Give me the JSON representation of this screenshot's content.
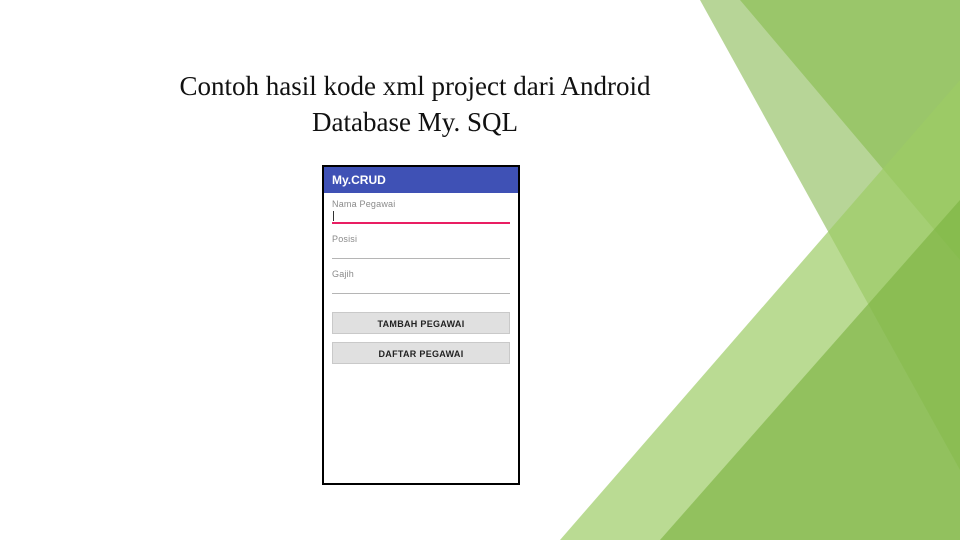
{
  "slide": {
    "title": "Contoh hasil kode xml project dari Android Database My. SQL"
  },
  "app": {
    "toolbar_title": "My.CRUD",
    "fields": {
      "f1_label": "Nama Pegawai",
      "f2_label": "Posisi",
      "f3_label": "Gajih"
    },
    "buttons": {
      "add_label": "TAMBAH PEGAWAI",
      "list_label": "DAFTAR PEGAWAI"
    }
  }
}
